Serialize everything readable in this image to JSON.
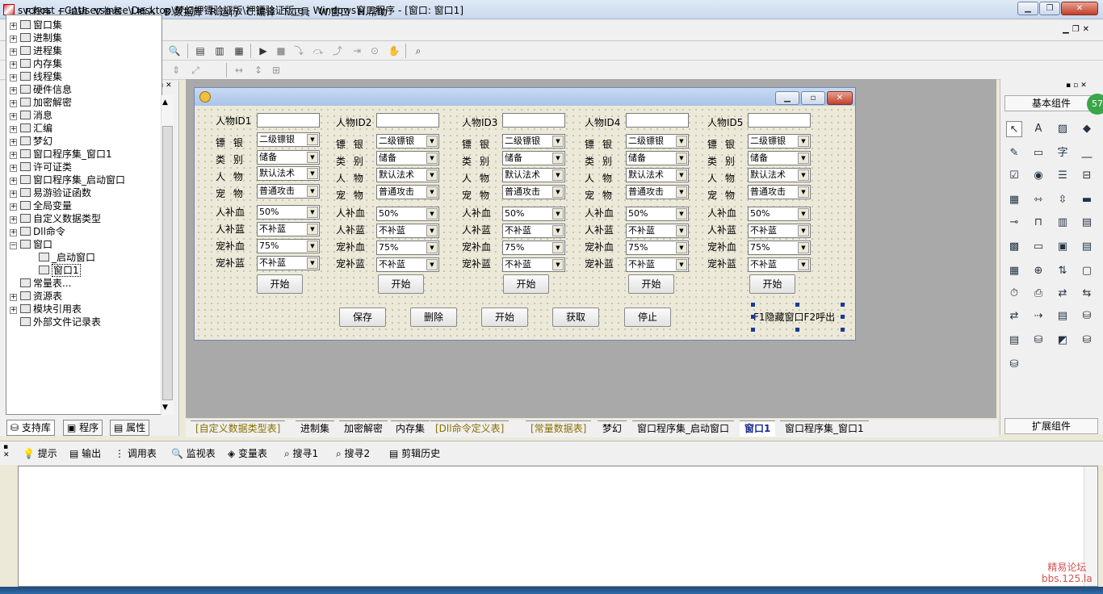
{
  "window": {
    "title": "svchost - C:\\Users\\nice\\Desktop\\梦幻押镖验证版\\押镖验证版.e - Windows窗口程序 - [窗口: 窗口1]"
  },
  "menu": [
    "F.程序",
    "E.编辑",
    "V.查看",
    "I.插入",
    "B.数据库",
    "R.运行",
    "C.编译",
    "T.工具",
    "W.窗口",
    "H.帮助"
  ],
  "tree": {
    "items": [
      "窗口集",
      "进制集",
      "进程集",
      "内存集",
      "线程集",
      "硬件信息",
      "加密解密",
      "消息",
      "汇编",
      "梦幻",
      "窗口程序集_窗口1",
      "许可证类",
      "窗口程序集_启动窗口",
      "易游验证函数",
      "全局变量",
      "自定义数据类型",
      "Dll命令",
      "窗口"
    ],
    "children": [
      "_启动窗口",
      "窗口1"
    ],
    "tail": [
      "常量表...",
      "资源表",
      "模块引用表",
      "外部文件记录表"
    ]
  },
  "left_tabs": [
    "支持库",
    "程序",
    "属性"
  ],
  "form": {
    "ids": [
      "人物ID1",
      "人物ID2",
      "人物ID3",
      "人物ID4",
      "人物ID5"
    ],
    "row_labels": {
      "silver": "镖 银",
      "category": "类 别",
      "person": "人 物",
      "pet": "宠 物",
      "hp": "人补血",
      "mp": "人补蓝",
      "pet_hp": "宠补血",
      "pet_mp": "宠补蓝"
    },
    "values": {
      "silver": "二级镖银",
      "category": "储备",
      "person": "默认法术",
      "pet": "普通攻击",
      "hp": "50%",
      "mp": "不补蓝",
      "pet_hp": "75%",
      "pet_mp": "不补蓝"
    },
    "start": "开始",
    "buttons": [
      "保存",
      "删除",
      "开始",
      "获取",
      "停止"
    ],
    "hint": "F1隐藏窗口F2呼出"
  },
  "right_panel": {
    "title": "基本组件",
    "footer": "扩展组件",
    "badge": "57"
  },
  "tabs": [
    "[自定义数据类型表]",
    "进制集",
    "加密解密",
    "内存集",
    "[Dll命令定义表]",
    "[常量数据表]",
    "梦幻",
    "窗口程序集_启动窗口",
    "窗口1",
    "窗口程序集_窗口1"
  ],
  "bottom_tabs": [
    "提示",
    "输出",
    "调用表",
    "监视表",
    "变量表",
    "搜寻1",
    "搜寻2",
    "剪辑历史"
  ],
  "watermark": {
    "line1": "精易论坛",
    "line2": "bbs.125.la"
  }
}
